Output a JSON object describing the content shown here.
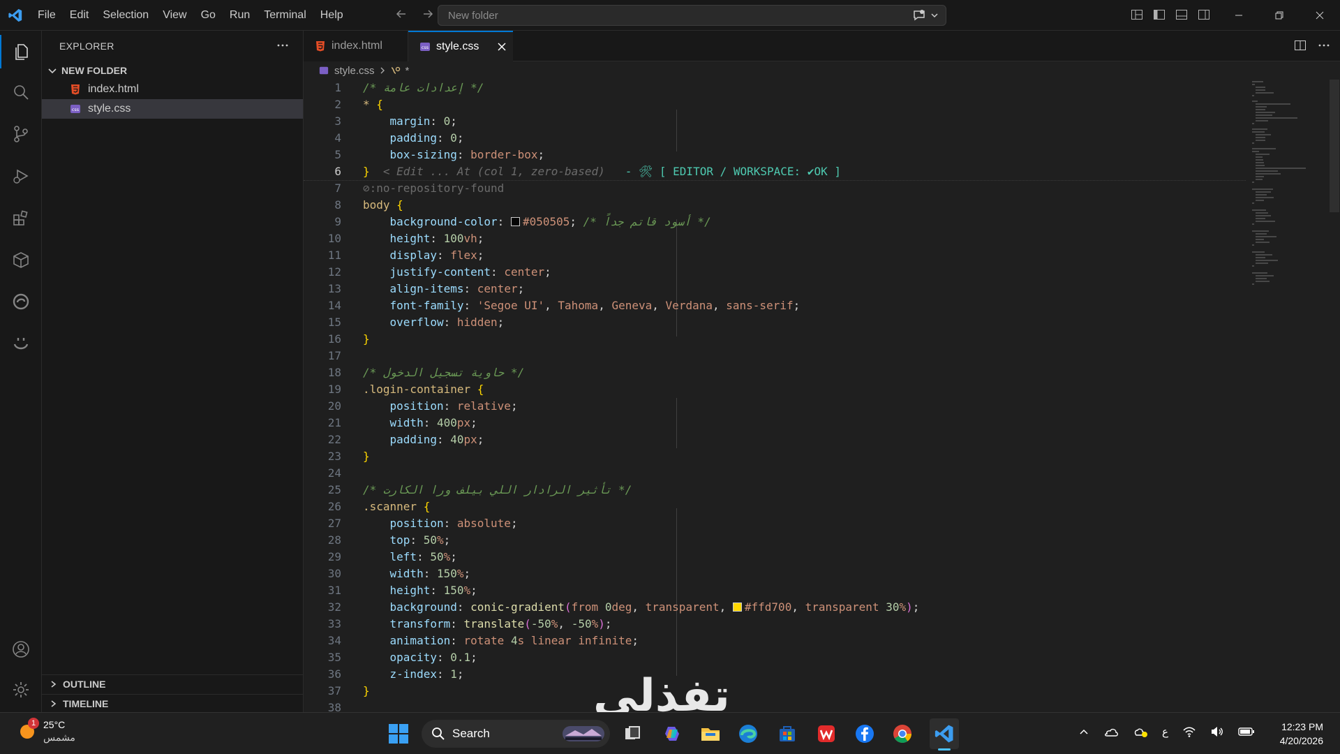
{
  "titlebar": {
    "menu": [
      "File",
      "Edit",
      "Selection",
      "View",
      "Go",
      "Run",
      "Terminal",
      "Help"
    ],
    "search_placeholder": "New folder"
  },
  "sidebar": {
    "title": "EXPLORER",
    "folder_name": "NEW FOLDER",
    "files": [
      "index.html",
      "style.css"
    ],
    "outline_label": "OUTLINE",
    "timeline_label": "TIMELINE"
  },
  "tabs": [
    {
      "label": "index.html",
      "active": false
    },
    {
      "label": "style.css",
      "active": true
    }
  ],
  "breadcrumb": {
    "file": "style.css",
    "symbol": "*"
  },
  "editor": {
    "active_line": 6,
    "inline_hint": "< Edit ... At (col 1, zero-based)",
    "inline_status": "- 🛠 [ EDITOR / WORKSPACE: ✔OK ]",
    "repo_hint": "⊘:no-repository-found"
  },
  "code_lines": [
    "/* إعدادات عامة */",
    "* {",
    "    margin: 0;",
    "    padding: 0;",
    "    box-sizing: border-box;",
    "}",
    "",
    "body {",
    "    background-color: #050505; /* أسود قاتم جداً */",
    "    height: 100vh;",
    "    display: flex;",
    "    justify-content: center;",
    "    align-items: center;",
    "    font-family: 'Segoe UI', Tahoma, Geneva, Verdana, sans-serif;",
    "    overflow: hidden;",
    "}",
    "",
    "/* حاوية تسجيل الدخول */",
    ".login-container {",
    "    position: relative;",
    "    width: 400px;",
    "    padding: 40px;",
    "}",
    "",
    "/* تأثير الرادار اللي بيلف ورا الكارت */",
    ".scanner {",
    "    position: absolute;",
    "    top: 50%;",
    "    left: 50%;",
    "    width: 150%;",
    "    height: 150%;",
    "    background: conic-gradient(from 0deg, transparent, #ffd700, transparent 30%);",
    "    transform: translate(-50%, -50%);",
    "    animation: rotate 4s linear infinite;",
    "    opacity: 0.1;",
    "    z-index: 1;",
    "}",
    ""
  ],
  "watermark": "تفذلي",
  "taskbar": {
    "weather_temp": "25°C",
    "weather_desc": "مشمس",
    "weather_badge": "1",
    "search_label": "Search",
    "time": "12:23 PM",
    "date": "4/20/2026",
    "lang": "ع"
  },
  "colors": {
    "accent": "#0078d4",
    "swatch_body": "#050505",
    "swatch_gold": "#ffd700"
  }
}
